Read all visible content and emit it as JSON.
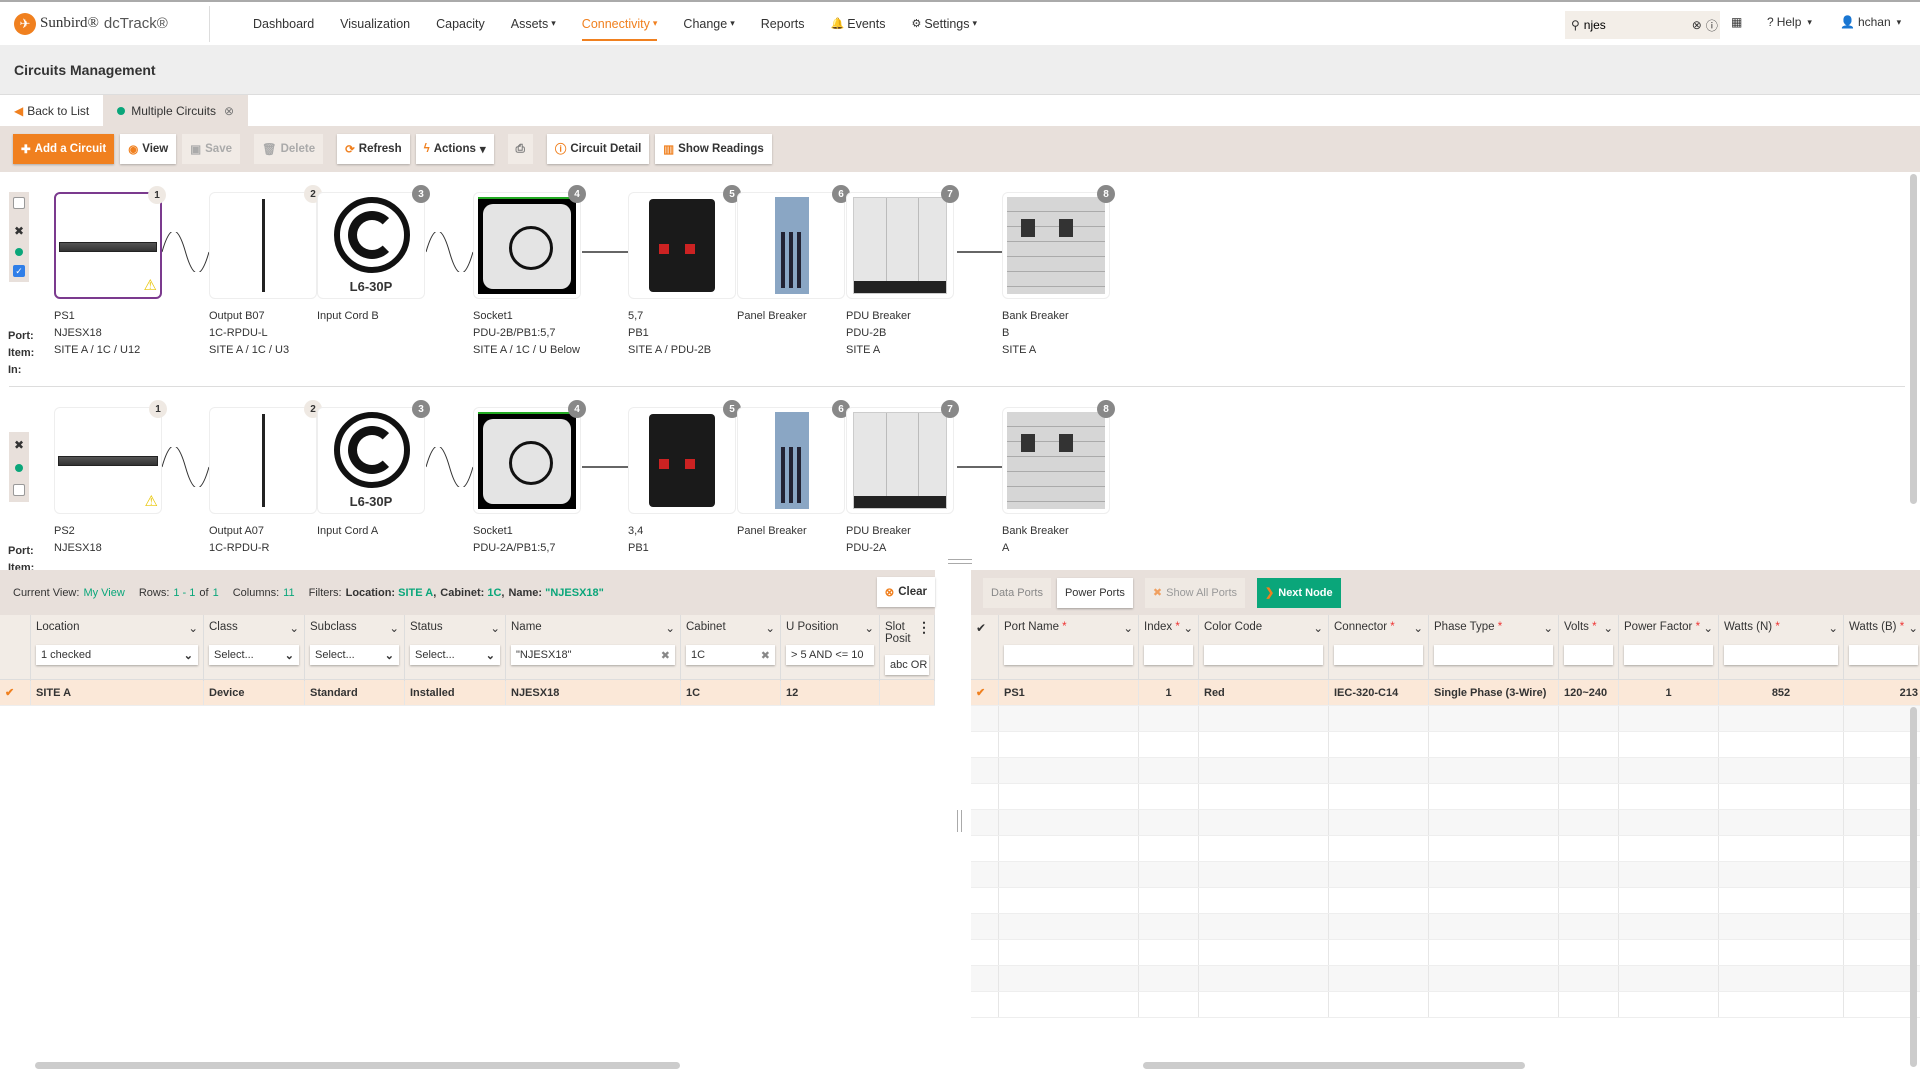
{
  "nav": {
    "brand": "Sunbird®",
    "product": "dcTrack®",
    "menu": [
      {
        "label": "Dashboard"
      },
      {
        "label": "Visualization"
      },
      {
        "label": "Capacity"
      },
      {
        "label": "Assets",
        "dropdown": true
      },
      {
        "label": "Connectivity",
        "dropdown": true,
        "active": true
      },
      {
        "label": "Change",
        "dropdown": true
      },
      {
        "label": "Reports"
      },
      {
        "label": "Events",
        "icon": "bell-icon"
      },
      {
        "label": "Settings",
        "dropdown": true,
        "icon": "gear-icon"
      }
    ],
    "search_value": "njes",
    "help": "Help",
    "user": "hchan"
  },
  "page_title": "Circuits Management",
  "tabs": {
    "back": "Back to List",
    "current": "Multiple Circuits"
  },
  "toolbar": {
    "add": "Add a Circuit",
    "view": "View",
    "save": "Save",
    "delete": "Delete",
    "refresh": "Refresh",
    "actions": "Actions",
    "circuit_detail": "Circuit Detail",
    "show_readings": "Show Readings"
  },
  "circuit_labels": {
    "port": "Port:",
    "item": "Item:",
    "in": "In:"
  },
  "circuits": [
    {
      "checked": true,
      "nodes": [
        {
          "num": "1",
          "type": "server",
          "port": "PS1",
          "item": "NJESX18",
          "in": "SITE A / 1C / U12",
          "warning": true,
          "selected": true
        },
        {
          "num": "2",
          "type": "rack-pdu",
          "port": "Output B07",
          "item": "1C-RPDU-L",
          "in": "SITE A / 1C / U3"
        },
        {
          "num": "3",
          "type": "plug",
          "plug_label": "L6-30P",
          "port": "Input Cord B"
        },
        {
          "num": "4",
          "type": "socket",
          "port": "Socket1",
          "item": "PDU-2B/PB1:5,7",
          "in": "SITE A / 1C / U Below"
        },
        {
          "num": "5",
          "type": "breaker",
          "port": "5,7",
          "item": "PB1",
          "in": "SITE A / PDU-2B"
        },
        {
          "num": "6",
          "type": "panel",
          "port": "Panel Breaker"
        },
        {
          "num": "7",
          "type": "pdu",
          "port": "PDU Breaker",
          "item": "PDU-2B",
          "in": "SITE A"
        },
        {
          "num": "8",
          "type": "bank",
          "port": "Bank Breaker",
          "item": "B",
          "in": "SITE A"
        }
      ]
    },
    {
      "checked": false,
      "nodes": [
        {
          "num": "1",
          "type": "server",
          "port": "PS2",
          "item": "NJESX18",
          "warning": true
        },
        {
          "num": "2",
          "type": "rack-pdu",
          "port": "Output A07",
          "item": "1C-RPDU-R"
        },
        {
          "num": "3",
          "type": "plug",
          "plug_label": "L6-30P",
          "port": "Input Cord A"
        },
        {
          "num": "4",
          "type": "socket",
          "port": "Socket1",
          "item": "PDU-2A/PB1:5,7"
        },
        {
          "num": "5",
          "type": "breaker",
          "port": "3,4",
          "item": "PB1"
        },
        {
          "num": "6",
          "type": "panel",
          "port": "Panel Breaker"
        },
        {
          "num": "7",
          "type": "pdu",
          "port": "PDU Breaker",
          "item": "PDU-2A"
        },
        {
          "num": "8",
          "type": "bank",
          "port": "Bank Breaker",
          "item": "A"
        }
      ]
    }
  ],
  "left_panel": {
    "current_view_label": "Current View:",
    "current_view": "My View",
    "rows_label": "Rows:",
    "rows_range": "1 - 1",
    "rows_of": "of",
    "rows_total": "1",
    "columns_label": "Columns:",
    "columns": "11",
    "filters_label": "Filters:",
    "filters": [
      {
        "name": "Location:",
        "value": "SITE A",
        "sep": ","
      },
      {
        "name": "Cabinet:",
        "value": "1C",
        "sep": ","
      },
      {
        "name": "Name:",
        "value": "\"NJESX18\"",
        "sep": ""
      }
    ],
    "clear": "Clear",
    "columns_def": [
      {
        "label": "Location",
        "filter": "1 checked",
        "kind": "select"
      },
      {
        "label": "Class",
        "filter": "Select...",
        "kind": "select"
      },
      {
        "label": "Subclass",
        "filter": "Select...",
        "kind": "select"
      },
      {
        "label": "Status",
        "filter": "Select...",
        "kind": "select"
      },
      {
        "label": "Name",
        "filter": "\"NJESX18\"",
        "kind": "clear"
      },
      {
        "label": "Cabinet",
        "filter": "1C",
        "kind": "clear"
      },
      {
        "label": "U Position",
        "filter": "> 5 AND <= 10",
        "kind": "text"
      },
      {
        "label": "Slot Posit",
        "filter": "abc OR xyz*.",
        "kind": "text"
      }
    ],
    "rows": [
      [
        "SITE A",
        "Device",
        "Standard",
        "Installed",
        "NJESX18",
        "1C",
        "12",
        ""
      ]
    ]
  },
  "right_panel": {
    "data_ports": "Data Ports",
    "power_ports": "Power Ports",
    "show_all": "Show All Ports",
    "next_node": "Next Node",
    "columns_def": [
      {
        "label": "Port Name",
        "required": true
      },
      {
        "label": "Index",
        "required": true
      },
      {
        "label": "Color Code",
        "required": false
      },
      {
        "label": "Connector",
        "required": true
      },
      {
        "label": "Phase Type",
        "required": true
      },
      {
        "label": "Volts",
        "required": true
      },
      {
        "label": "Power Factor",
        "required": true
      },
      {
        "label": "Watts (N)",
        "required": true
      },
      {
        "label": "Watts (B)",
        "required": true
      }
    ],
    "rows": [
      [
        "PS1",
        "1",
        "Red",
        "IEC-320-C14",
        "Single Phase (3-Wire)",
        "120~240",
        "1",
        "852",
        "213"
      ]
    ]
  },
  "colors": {
    "accent": "#f0801f",
    "green": "#0aa67a",
    "selected_row": "#fbe8d8",
    "selected_node": "#7b3a8e"
  }
}
